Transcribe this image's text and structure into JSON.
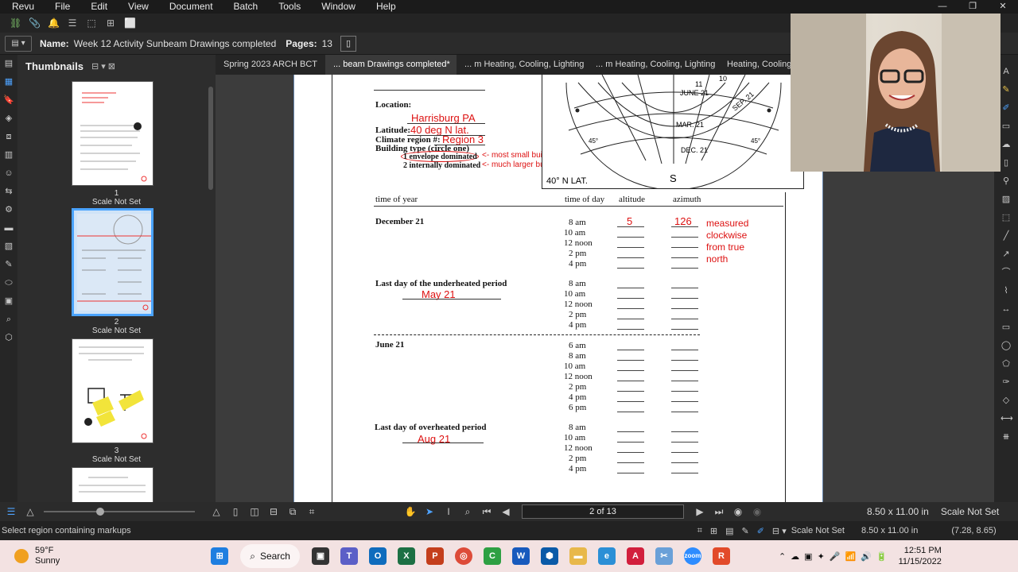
{
  "app": {
    "menu": [
      "Revu",
      "File",
      "Edit",
      "View",
      "Document",
      "Batch",
      "Tools",
      "Window",
      "Help"
    ]
  },
  "properties": {
    "name_label": "Name:",
    "name_value": "Week 12 Activity Sunbeam Drawings completed",
    "pages_label": "Pages:",
    "pages_value": "13"
  },
  "thumbnails": {
    "title": "Thumbnails",
    "items": [
      {
        "num": "1",
        "label": "Scale Not Set"
      },
      {
        "num": "2",
        "label": "Scale Not Set"
      },
      {
        "num": "3",
        "label": "Scale Not Set"
      }
    ]
  },
  "tabs": [
    {
      "label": "Spring 2023 ARCH BCT"
    },
    {
      "label": "... beam Drawings completed*"
    },
    {
      "label": "... m Heating, Cooling, Lighting"
    },
    {
      "label": "... m Heating, Cooling, Lighting"
    },
    {
      "label": "Heating, Cooling, L"
    }
  ],
  "document": {
    "location_label": "Location:",
    "location_value": "Harrisburg PA",
    "latitude_label": "Latitude:",
    "latitude_value": "40 deg N lat.",
    "climate_label": "Climate region #:",
    "climate_value": "Region 3",
    "building_type_label": "Building type (circle one)",
    "option1": "1 envelope dominated",
    "option2": "2 internally dominated",
    "note1": "<- most small buildings",
    "note2": "<- much larger buildings",
    "chart_lat": "40° N LAT.",
    "chart_s": "S",
    "chart_labels": [
      "JUNE 21",
      "MAR. 21",
      "DEC. 21",
      "SEP. 21",
      "11",
      "10",
      "45°",
      "45°"
    ],
    "col_time_of_year": "time of year",
    "col_time_of_day": "time of day",
    "col_altitude": "altitude",
    "col_azimuth": "azimuth",
    "sections": [
      {
        "name": "December 21",
        "sub": "",
        "times": [
          "8 am",
          "10 am",
          "12 noon",
          "2 pm",
          "4 pm"
        ]
      },
      {
        "name": "Last day of the underheated period",
        "sub": "May 21",
        "times": [
          "8 am",
          "10 am",
          "12 noon",
          "2 pm",
          "4 pm"
        ]
      },
      {
        "name": "June 21",
        "sub": "",
        "times": [
          "6 am",
          "8 am",
          "10 am",
          "12 noon",
          "2 pm",
          "4 pm",
          "6 pm"
        ]
      },
      {
        "name": "Last day of overheated period",
        "sub": "Aug 21",
        "times": [
          "8 am",
          "10 am",
          "12 noon",
          "2 pm",
          "4 pm"
        ]
      }
    ],
    "dec_alt_8am": "5",
    "dec_az_8am": "126",
    "azimuth_note": [
      "measured",
      "clockwise",
      "from true",
      "north"
    ]
  },
  "nav": {
    "page_indicator": "2 of 13",
    "page_size": "8.50 x 11.00 in",
    "scale": "Scale Not Set"
  },
  "status": {
    "hint": "Select region containing markups",
    "scale": "Scale Not Set",
    "size": "8.50 x 11.00 in",
    "coords": "(7.28, 8.65)"
  },
  "taskbar": {
    "temp": "59°F",
    "weather": "Sunny",
    "search": "Search",
    "time": "12:51 PM",
    "date": "11/15/2022"
  }
}
